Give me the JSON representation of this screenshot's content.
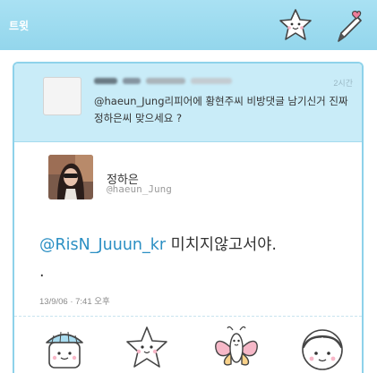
{
  "header": {
    "title": "트윗",
    "star_icon": "star-face-icon",
    "compose_icon": "pencil-heart-icon"
  },
  "reply": {
    "time": "2시간",
    "text": "@haeun_Jung리피어에 황현주씨 비방댓글 남기신거 진짜 정하은씨 맞으세요 ?"
  },
  "tweet": {
    "name": "정하은",
    "handle": "@haeun_Jung",
    "mention": "@RisN_Juuun_kr",
    "body": " 미치지않고서야.",
    "tail": ".",
    "time": "13/9/06 · 7:41 오후"
  },
  "actions": {
    "reply_icon": "house-face-icon",
    "retweet_icon": "star-face-icon",
    "favorite_icon": "butterfly-icon",
    "more_icon": "girl-face-icon"
  },
  "colors": {
    "header": "#93d6ec",
    "reply_bg": "#c9ecf8",
    "mention": "#2b8fc3"
  }
}
